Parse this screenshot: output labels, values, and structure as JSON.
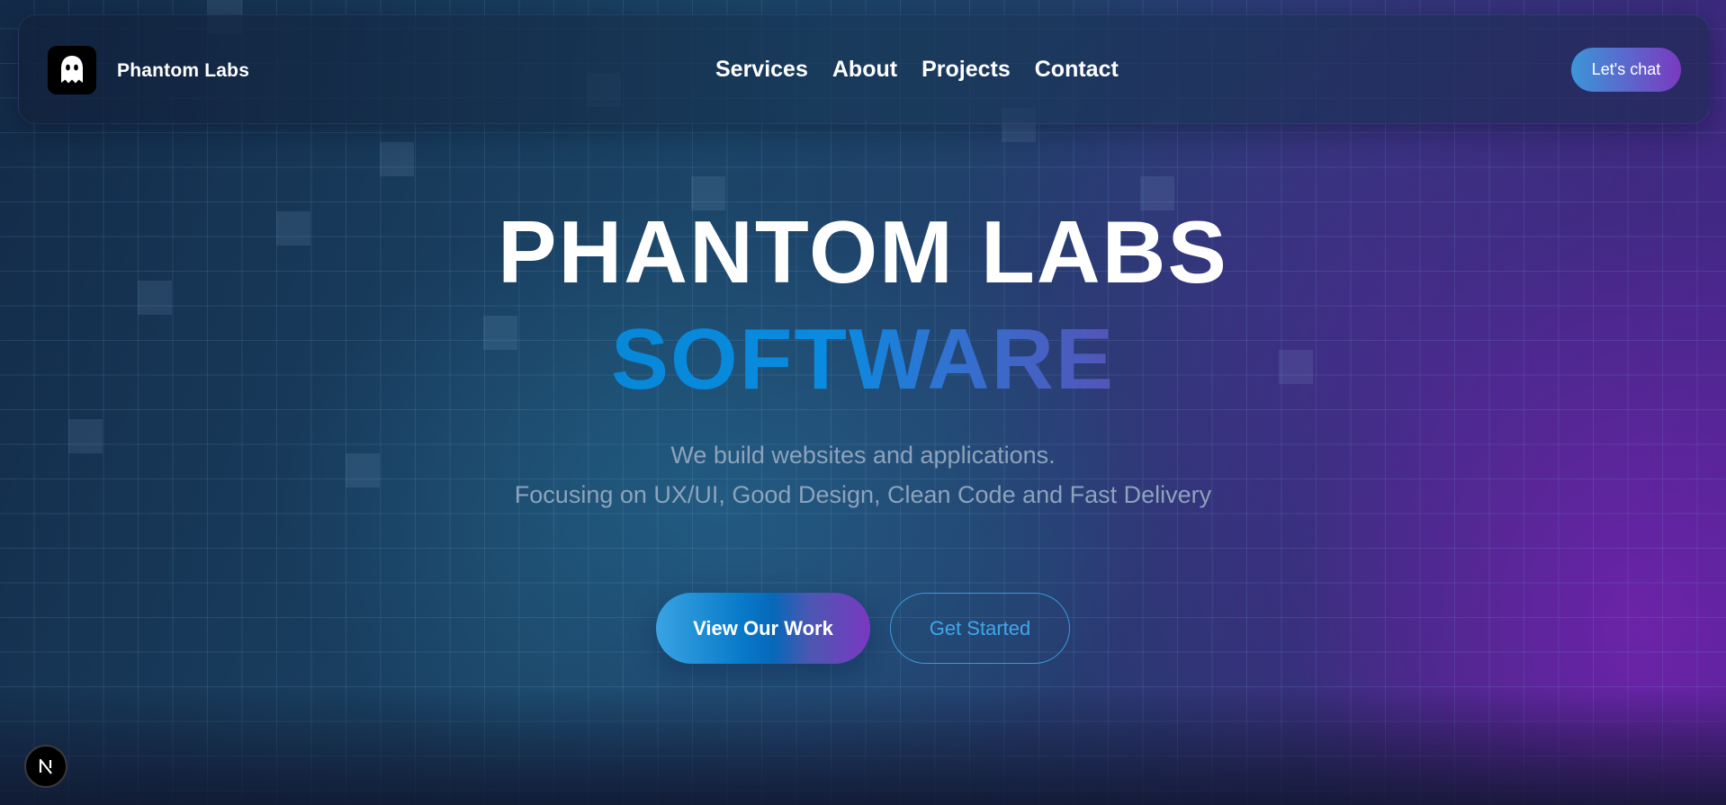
{
  "header": {
    "brand": "Phantom Labs",
    "logo_icon": "ghost-icon",
    "nav": [
      {
        "label": "Services"
      },
      {
        "label": "About"
      },
      {
        "label": "Projects"
      },
      {
        "label": "Contact"
      }
    ],
    "cta_label": "Let's chat"
  },
  "hero": {
    "title": "PHANTOM LABS",
    "subtitle": "SOFTWARE",
    "tagline_1": "We build websites and applications.",
    "tagline_2": "Focusing on UX/UI, Good Design, Clean Code and Fast Delivery",
    "primary_button": "View Our Work",
    "secondary_button": "Get Started"
  },
  "devtools_badge": {
    "icon": "nextjs-n-icon",
    "letter": "N"
  },
  "colors": {
    "accent_blue": "#0a8be0",
    "accent_purple": "#7a38c2",
    "tagline_gray": "#8da3bc"
  }
}
